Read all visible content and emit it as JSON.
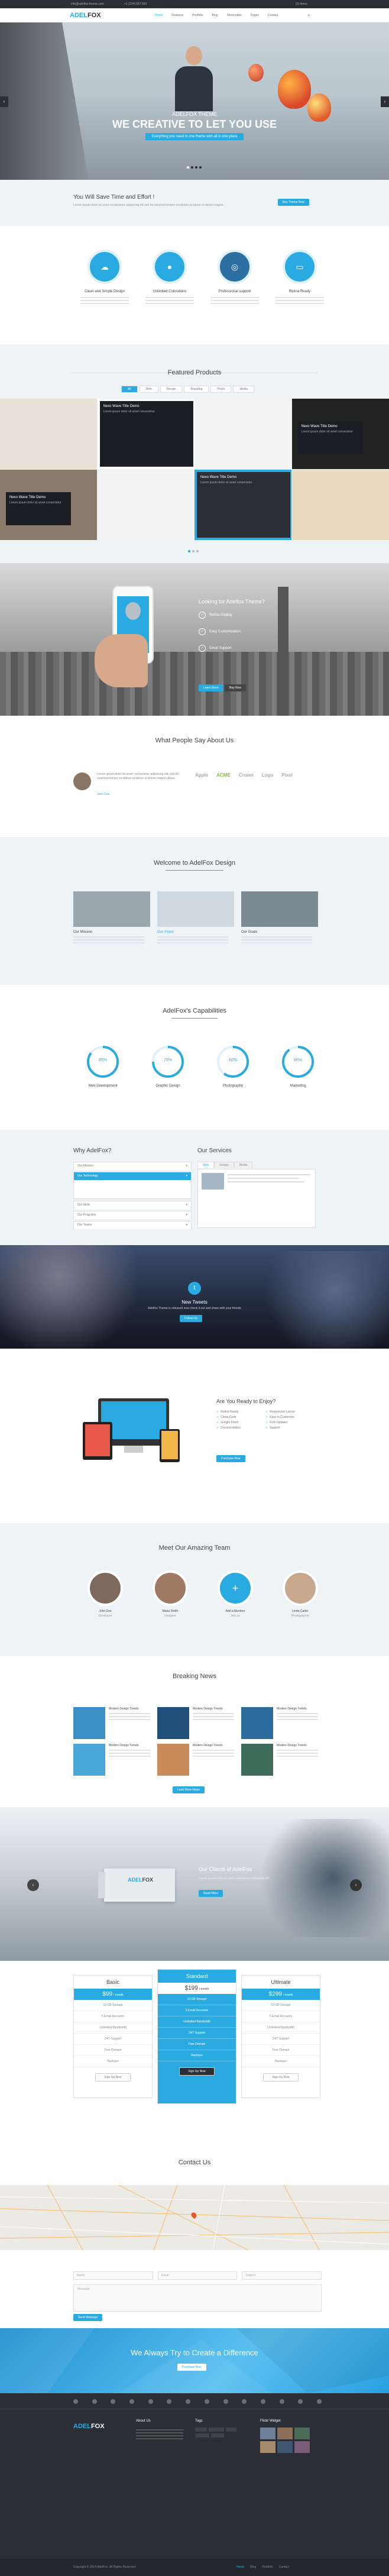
{
  "topbar": {
    "email": "info@adelfox-theme.com",
    "phone": "+1 (234) 567 890",
    "cart": "(0) Items"
  },
  "nav": {
    "logo_a": "ADEL",
    "logo_b": "FOX",
    "items": [
      "Home",
      "Features",
      "Portfolio",
      "Blog",
      "Shortcodes",
      "Pages",
      "Contact"
    ]
  },
  "hero": {
    "small": "ADELFOX THEME",
    "big": "WE CREATIVE TO LET YOU USE",
    "caption": "Everything you need in one theme with all in one place"
  },
  "callout": {
    "title": "You Will Save Time and Effort !",
    "text": "Lorem ipsum dolor sit amet consectetur adipiscing elit sed do eiusmod tempor incididunt ut labore et dolore magna",
    "button": "Buy Theme Now"
  },
  "features": [
    {
      "title": "Clean and Simple Design",
      "icon": "cloud-icon"
    },
    {
      "title": "Unlimited Colorations",
      "icon": "drop-icon"
    },
    {
      "title": "Professional support",
      "icon": "lifebuoy-icon"
    },
    {
      "title": "Retina Ready",
      "icon": "monitor-icon"
    }
  ],
  "products": {
    "title": "Featured Products",
    "filters": [
      "All",
      "Web",
      "Design",
      "Branding",
      "Photo",
      "Media"
    ],
    "card_title": "Nexo Wave Title Demo",
    "card_text": "Lorem ipsum dolor sit amet consectetur"
  },
  "app": {
    "title": "Looking for Adelfox Theme?",
    "items": [
      "Retina Display",
      "Easy Customization",
      "Great Support"
    ],
    "button_a": "Learn More",
    "button_b": "Buy Now"
  },
  "testimonials": {
    "title": "What People Say About Us",
    "quote": "Lorem ipsum dolor sit amet, consectetur adipiscing elit, sed do eiusmod tempor incididunt ut labore et dolore magna aliqua.",
    "name": "John Doe",
    "logos": [
      "Apple",
      "ACME",
      "Crown",
      "Logo",
      "Pixel"
    ]
  },
  "welcome": {
    "title": "Welcome to AdelFox Design",
    "items": [
      "Our Mission",
      "Our Vision",
      "Our Goals"
    ]
  },
  "capabilities": {
    "title": "AdelFox's Capabilities",
    "items": [
      {
        "label": "Web Development",
        "value": "85%",
        "frac": 0.85
      },
      {
        "label": "Graphic Design",
        "value": "75%",
        "frac": 0.75
      },
      {
        "label": "Photography",
        "value": "60%",
        "frac": 0.6
      },
      {
        "label": "Marketing",
        "value": "90%",
        "frac": 0.9
      }
    ]
  },
  "why": {
    "title": "Why AdelFox?",
    "items": [
      "Our Mission",
      "Our Technology",
      "Our Skills",
      "Our Programs",
      "Our Teams"
    ]
  },
  "services": {
    "title": "Our Services",
    "tabs": [
      "Web",
      "Design",
      "Media"
    ]
  },
  "tweets": {
    "title": "New Tweets",
    "text": "Adelfox Theme is released now check it out and share with your friends",
    "button": "Follow Us"
  },
  "enjoy": {
    "title": "Are You Ready to Enjoy?",
    "list": [
      "Retina Ready",
      "Responsive Layout",
      "Clean Code",
      "Easy to Customize",
      "Google Fonts",
      "Free Updates",
      "Documentation",
      "Support"
    ],
    "button": "Purchase Now"
  },
  "team": {
    "title": "Meet Our Amazing Team",
    "members": [
      {
        "name": "John Doe",
        "role": "Developer"
      },
      {
        "name": "Maria Smith",
        "role": "Designer"
      },
      {
        "name": "Add a Member",
        "role": "Join us"
      },
      {
        "name": "Linda Carter",
        "role": "Photographer"
      }
    ]
  },
  "news": {
    "title": "Breaking News",
    "item_title": "Modern Design Trends",
    "button": "Load More News"
  },
  "clients": {
    "title": "Our Clients of AdelFox",
    "text": "Lorem ipsum dolor sit amet consectetur adipiscing elit",
    "button": "Read More"
  },
  "pricing": {
    "plans": [
      {
        "name": "Basic",
        "price": "$99",
        "period": "/ month"
      },
      {
        "name": "Standard",
        "price": "$199",
        "period": "/ month"
      },
      {
        "name": "Ultimate",
        "price": "$299",
        "period": "/ month"
      }
    ],
    "features": [
      "10 GB Storage",
      "5 Email Accounts",
      "Unlimited Bandwidth",
      "24/7 Support",
      "Free Domain",
      "Backups"
    ],
    "button": "Sign Up Now"
  },
  "contact": {
    "title": "Contact Us",
    "fields": [
      "Name",
      "Email",
      "Subject"
    ],
    "message": "Message",
    "button": "Send Message"
  },
  "cta": {
    "title": "We Always Try to Create a Difference",
    "button": "Purchase Now"
  },
  "footer": {
    "col_a": "About Us",
    "col_b": "Tags",
    "col_c": "Flickr Widget",
    "copyright": "Copyright © 2014 AdelFox. All Rights Reserved.",
    "links": [
      "Home",
      "Blog",
      "Portfolio",
      "Contact"
    ]
  },
  "colors": {
    "accent": "#29abe2",
    "dark": "#2b2f35"
  }
}
